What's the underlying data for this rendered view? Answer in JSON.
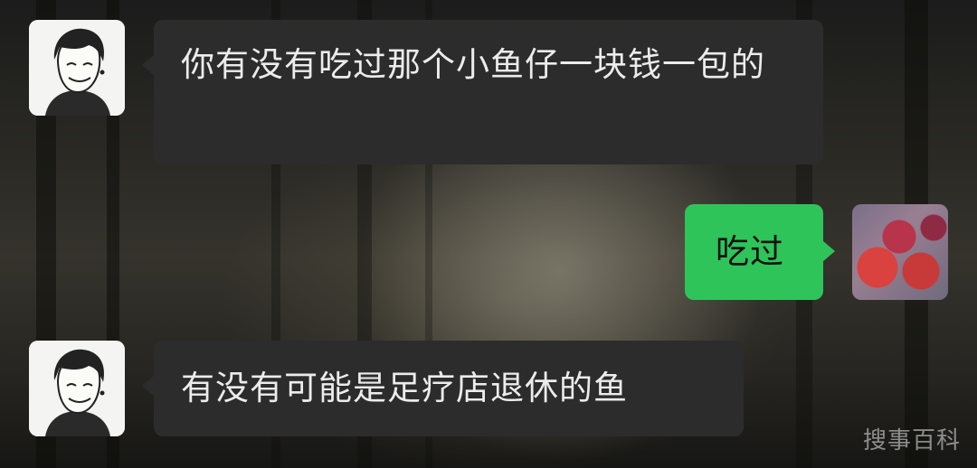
{
  "chat": {
    "messages": [
      {
        "sender": "contact",
        "text": "你有没有吃过那个小鱼仔一块钱一包的"
      },
      {
        "sender": "me",
        "text": "吃过"
      },
      {
        "sender": "contact",
        "text": "有没有可能是足疗店退休的鱼"
      }
    ],
    "contact_avatar_icon": "cartoon-boy-avatar",
    "my_avatar_icon": "strawberry-avatar"
  },
  "watermark": "搜事百科",
  "colors": {
    "incoming_bubble": "#2c2c2c",
    "outgoing_bubble": "#2ec45a",
    "incoming_text": "#ececec",
    "outgoing_text": "#111111"
  }
}
